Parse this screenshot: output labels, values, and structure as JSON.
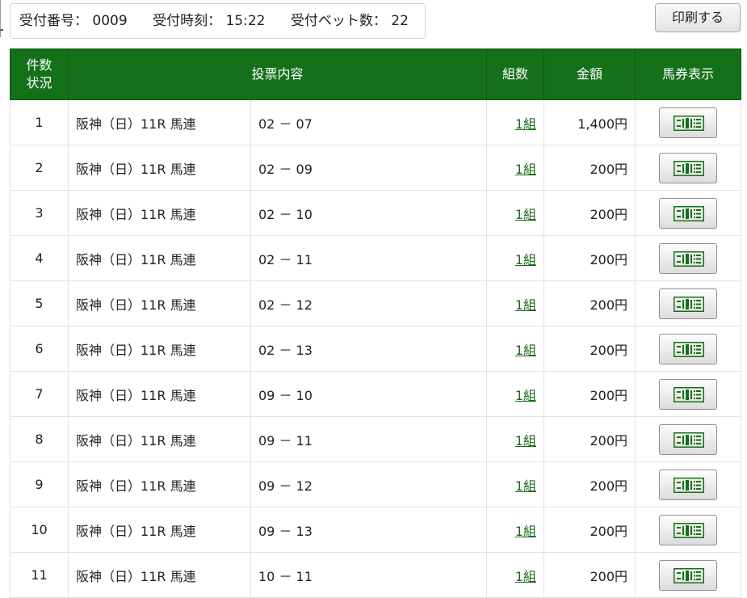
{
  "header_info": {
    "receipt_no_label": "受付番号：",
    "receipt_no": "0009",
    "receipt_time_label": "受付時刻：",
    "receipt_time": "15:22",
    "bet_count_label": "受付ベット数：",
    "bet_count": "22"
  },
  "print_button": "印刷する",
  "table": {
    "headers": {
      "count_status": "件数\n状況",
      "content": "投票内容",
      "combos": "組数",
      "amount": "金額",
      "ticket_display": "馬券表示"
    },
    "rows": [
      {
        "no": "1",
        "race": "阪神（日）11R 馬連",
        "combo": "02 － 07",
        "count": "1組",
        "amount": "1,400円"
      },
      {
        "no": "2",
        "race": "阪神（日）11R 馬連",
        "combo": "02 － 09",
        "count": "1組",
        "amount": "200円"
      },
      {
        "no": "3",
        "race": "阪神（日）11R 馬連",
        "combo": "02 － 10",
        "count": "1組",
        "amount": "200円"
      },
      {
        "no": "4",
        "race": "阪神（日）11R 馬連",
        "combo": "02 － 11",
        "count": "1組",
        "amount": "200円"
      },
      {
        "no": "5",
        "race": "阪神（日）11R 馬連",
        "combo": "02 － 12",
        "count": "1組",
        "amount": "200円"
      },
      {
        "no": "6",
        "race": "阪神（日）11R 馬連",
        "combo": "02 － 13",
        "count": "1組",
        "amount": "200円"
      },
      {
        "no": "7",
        "race": "阪神（日）11R 馬連",
        "combo": "09 － 10",
        "count": "1組",
        "amount": "200円"
      },
      {
        "no": "8",
        "race": "阪神（日）11R 馬連",
        "combo": "09 － 11",
        "count": "1組",
        "amount": "200円"
      },
      {
        "no": "9",
        "race": "阪神（日）11R 馬連",
        "combo": "09 － 12",
        "count": "1組",
        "amount": "200円"
      },
      {
        "no": "10",
        "race": "阪神（日）11R 馬連",
        "combo": "09 － 13",
        "count": "1組",
        "amount": "200円"
      },
      {
        "no": "11",
        "race": "阪神（日）11R 馬連",
        "combo": "10 － 11",
        "count": "1組",
        "amount": "200円"
      }
    ]
  },
  "ticket_icon": "ticket-icon",
  "colors": {
    "header_green": "#15701a",
    "link_green": "#1b6a1b"
  }
}
